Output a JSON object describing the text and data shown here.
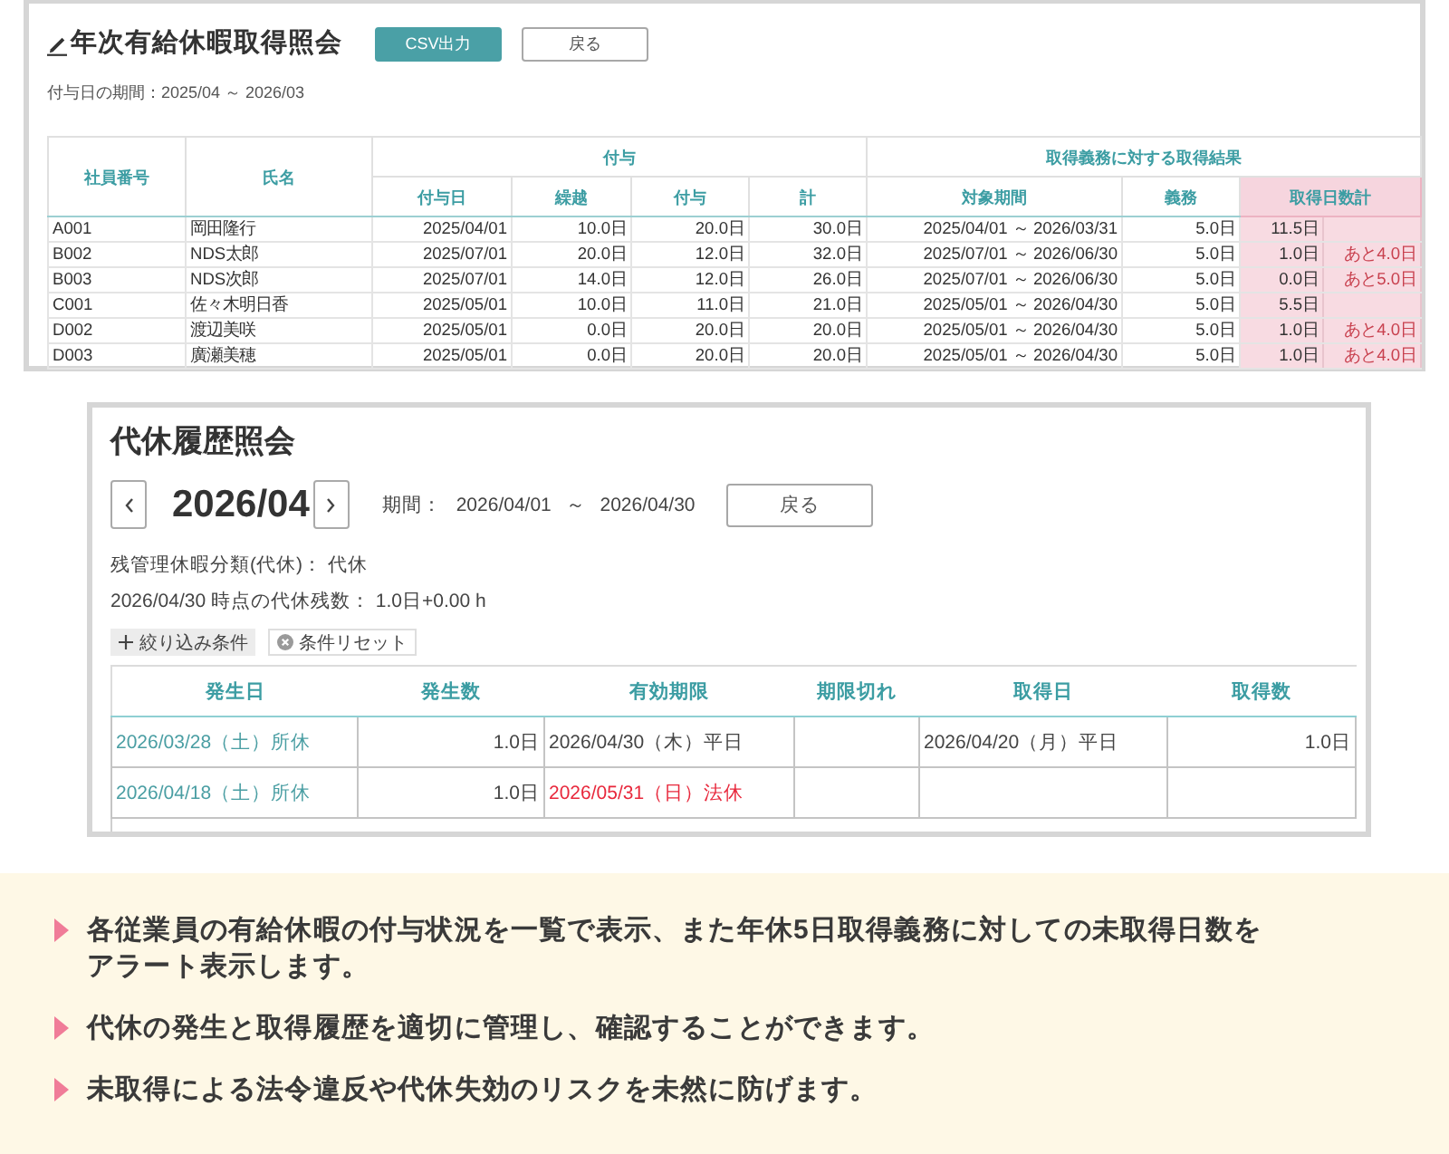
{
  "annual_leave": {
    "title": "年次有給休暇取得照会",
    "buttons": [
      {
        "label": "CSV出力",
        "kind": "primary"
      },
      {
        "label": "戻る",
        "kind": "secondary"
      }
    ],
    "period": "付与日の期間：2025/04 ～ 2026/03",
    "table": {
      "columns": [
        {
          "label": "社員番号",
          "highlighted": false
        },
        {
          "label": "氏名",
          "highlighted": false
        },
        {
          "label": "付与",
          "colspan": 4,
          "children": [
            {
              "label": "付与日",
              "highlighted": false
            },
            {
              "label": "繰越",
              "highlighted": false
            },
            {
              "label": "付与",
              "highlighted": false
            },
            {
              "label": "計",
              "highlighted": false
            }
          ]
        },
        {
          "label": "取得義務に対する取得結果",
          "colspan": 4,
          "children": [
            {
              "label": "対象期間",
              "highlighted": false
            },
            {
              "label": "義務",
              "highlighted": false
            },
            {
              "label": "取得日数計",
              "colspan": 2,
              "highlighted": true
            }
          ]
        }
      ],
      "rows": [
        {
          "cells": [
            "A001",
            "岡田隆行",
            "2025/04/01",
            "10.0日",
            "20.0日",
            "30.0日",
            "2025/04/01 ～ 2026/03/31",
            "5.0日",
            "11.5日"
          ]
        },
        {
          "cells": [
            "B002",
            "NDS太郎",
            "2025/07/01",
            "20.0日",
            "12.0日",
            "32.0日",
            "2025/07/01 ～ 2026/06/30",
            "5.0日",
            "1.0日"
          ],
          "shortfall": "あと4.0日"
        },
        {
          "cells": [
            "B003",
            "NDS次郎",
            "2025/07/01",
            "14.0日",
            "12.0日",
            "26.0日",
            "2025/07/01 ～ 2026/06/30",
            "5.0日",
            "0.0日"
          ],
          "shortfall": "あと5.0日"
        },
        {
          "cells": [
            "C001",
            "佐々木明日香",
            "2025/05/01",
            "10.0日",
            "11.0日",
            "21.0日",
            "2025/05/01 ～ 2026/04/30",
            "5.0日",
            "5.5日"
          ]
        },
        {
          "cells": [
            "D002",
            "渡辺美咲",
            "2025/05/01",
            "0.0日",
            "20.0日",
            "20.0日",
            "2025/05/01 ～ 2026/04/30",
            "5.0日",
            "1.0日"
          ],
          "shortfall": "あと4.0日"
        },
        {
          "cells": [
            "D003",
            "廣瀬美穂",
            "2025/05/01",
            "0.0日",
            "20.0日",
            "20.0日",
            "2025/05/01 ～ 2026/04/30",
            "5.0日",
            "1.0日"
          ],
          "shortfall": "あと4.0日"
        }
      ]
    }
  },
  "substitute_leave": {
    "title": "代休履歴照会",
    "month": "2026/04",
    "period": "期間： 2026/04/01 ～ 2026/04/30",
    "back_button": "戻る",
    "info": [
      "残管理休暇分類(代休)： 代休",
      "2026/04/30 時点の代休残数： 1.0日+0.00 h"
    ],
    "filters": [
      {
        "label": "絞り込み条件",
        "kind": "add"
      },
      {
        "label": "条件リセット",
        "kind": "reset"
      }
    ],
    "table": {
      "columns": [
        "発生日",
        "発生数",
        "有効期限",
        "期限切れ",
        "取得日",
        "取得数"
      ],
      "rows": [
        {
          "occurred_date": "2026/03/28（土）所休",
          "occurred_count": "1.0日",
          "expiry": "2026/04/30（木）平日",
          "expiry_warning": false,
          "taken_date": "2026/04/20（月）平日",
          "taken_count": "1.0日"
        },
        {
          "occurred_date": "2026/04/18（土）所休",
          "occurred_count": "1.0日",
          "expiry": "2026/05/31（日）法休",
          "expiry_warning": true
        }
      ]
    }
  },
  "points": [
    "各従業員の有給休暇の付与状況を一覧で表示、また年休5日取得義務に対しての未取得日数をアラート表示します。",
    "代休の発生と取得履歴を適切に管理し、確認することができます。",
    "未取得による法令違反や代休失効のリスクを未然に防げます。"
  ]
}
